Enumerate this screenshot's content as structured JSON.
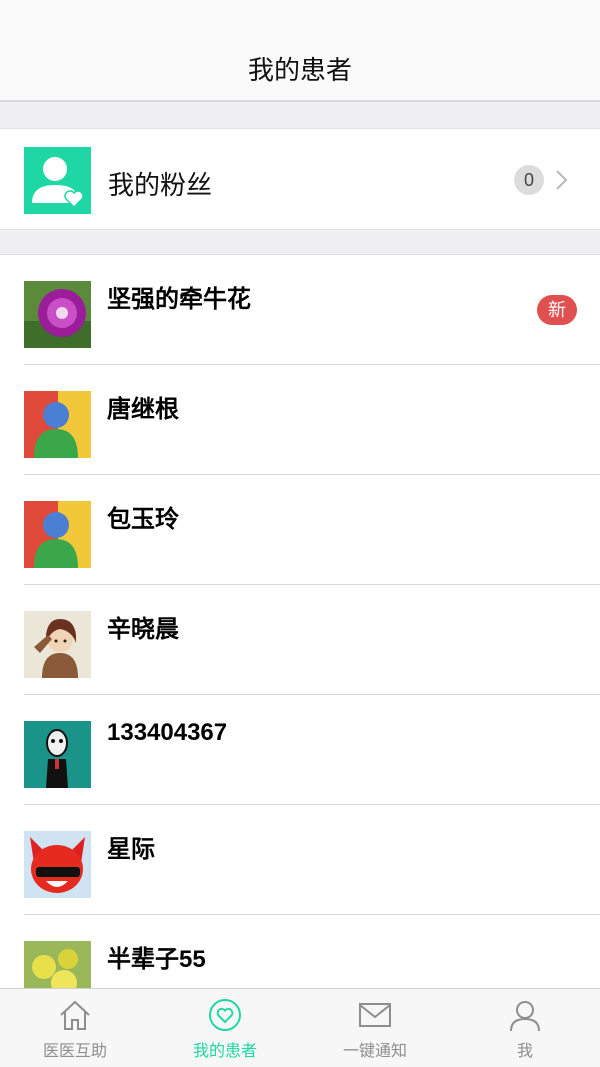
{
  "header": {
    "title": "我的患者"
  },
  "fans": {
    "label": "我的粉丝",
    "count": "0"
  },
  "patients": [
    {
      "name": "坚强的牵牛花",
      "badge": "新",
      "avatar_icon": "morning-glory-photo"
    },
    {
      "name": "唐继根",
      "badge": "",
      "avatar_icon": "default-user-avatar"
    },
    {
      "name": "包玉玲",
      "badge": "",
      "avatar_icon": "default-user-avatar"
    },
    {
      "name": "辛晓晨",
      "badge": "",
      "avatar_icon": "saluting-soldier-avatar"
    },
    {
      "name": "133404367",
      "badge": "",
      "avatar_icon": "masked-character-avatar"
    },
    {
      "name": "星际",
      "badge": "",
      "avatar_icon": "red-fox-avatar"
    },
    {
      "name": "半辈子55",
      "badge": "",
      "avatar_icon": "yellow-flowers-photo"
    }
  ],
  "tabs": [
    {
      "label": "医医互助",
      "icon": "home-icon",
      "active": false
    },
    {
      "label": "我的患者",
      "icon": "heart-circle-icon",
      "active": true
    },
    {
      "label": "一键通知",
      "icon": "envelope-icon",
      "active": false
    },
    {
      "label": "我",
      "icon": "person-icon",
      "active": false
    }
  ],
  "colors": {
    "accent": "#1fd7a4",
    "badge_red": "#e05050",
    "inactive": "#8e8e8e"
  }
}
